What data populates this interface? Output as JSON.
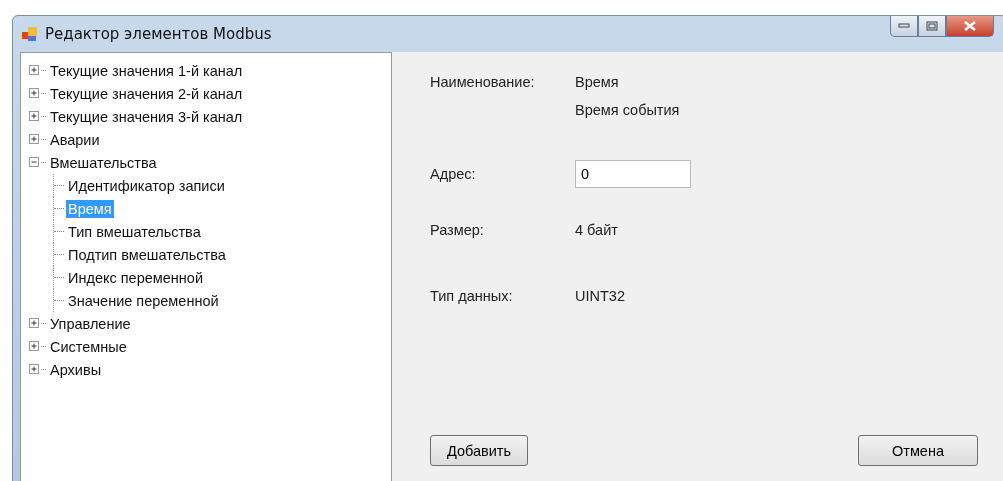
{
  "window": {
    "title": "Редактор элементов Modbus"
  },
  "tree": [
    {
      "label": "Текущие значения 1-й канал",
      "expanded": false,
      "selected": false
    },
    {
      "label": "Текущие значения 2-й канал",
      "expanded": false,
      "selected": false
    },
    {
      "label": "Текущие значения 3-й канал",
      "expanded": false,
      "selected": false
    },
    {
      "label": "Аварии",
      "expanded": false,
      "selected": false
    },
    {
      "label": "Вмешательства",
      "expanded": true,
      "selected": false,
      "children": [
        {
          "label": "Идентификатор записи",
          "selected": false
        },
        {
          "label": "Время",
          "selected": true
        },
        {
          "label": "Тип вмешательства",
          "selected": false
        },
        {
          "label": "Подтип вмешательства",
          "selected": false
        },
        {
          "label": "Индекс переменной",
          "selected": false
        },
        {
          "label": "Значение переменной",
          "selected": false
        }
      ]
    },
    {
      "label": "Управление",
      "expanded": false,
      "selected": false
    },
    {
      "label": "Системные",
      "expanded": false,
      "selected": false
    },
    {
      "label": "Архивы",
      "expanded": false,
      "selected": false
    }
  ],
  "details": {
    "name_label": "Наименование:",
    "name_value": "Время",
    "description": "Время события",
    "address_label": "Адрес:",
    "address_value": "0",
    "size_label": "Размер:",
    "size_value": "4 байт",
    "type_label": "Тип данных:",
    "type_value": "UINT32"
  },
  "buttons": {
    "add": "Добавить",
    "cancel": "Отмена"
  }
}
